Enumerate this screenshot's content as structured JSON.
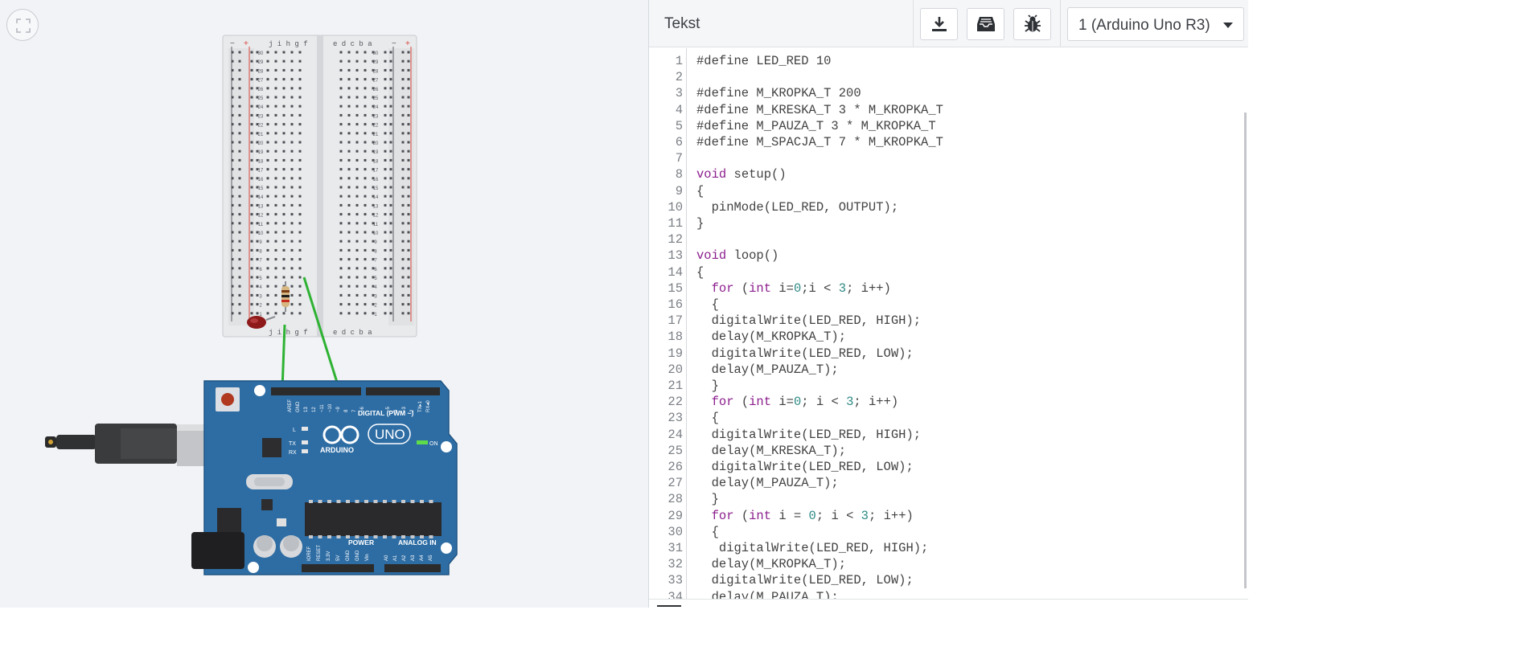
{
  "workspace": {
    "fit_icon": "fit-to-view-icon",
    "breadboard": {
      "row_numbers": [
        "30",
        "29",
        "28",
        "27",
        "26",
        "25",
        "24",
        "23",
        "22",
        "21",
        "20",
        "19",
        "18",
        "17",
        "16",
        "15",
        "14",
        "13",
        "12",
        "11",
        "10",
        "9",
        "8",
        "7",
        "6",
        "5",
        "4",
        "3",
        "2",
        "1"
      ],
      "left_columns": "j i h g f",
      "right_columns": "e d c b a",
      "rail_minus": "−",
      "rail_plus": "+"
    },
    "arduino": {
      "brand": "ARDUINO",
      "model": "UNO",
      "digital_label": "DIGITAL (PWM ~)",
      "power_label": "POWER",
      "analog_label": "ANALOG IN",
      "on_label": "ON",
      "tx_label": "TX",
      "rx_label": "RX",
      "l_label": "L",
      "digital_pins": [
        "AREF",
        "GND",
        "13",
        "12",
        "~11",
        "~10",
        "~9",
        "8",
        "7",
        "~6",
        "~5",
        "4",
        "~3",
        "2",
        "TX▸1",
        "RX◂0"
      ],
      "power_pins": [
        "IOREF",
        "RESET",
        "3.3V",
        "5V",
        "GND",
        "GND",
        "Vin"
      ],
      "analog_pins": [
        "A0",
        "A1",
        "A2",
        "A3",
        "A4",
        "A5"
      ]
    }
  },
  "code_panel": {
    "mode_label": "Tekst",
    "toolbar": {
      "download_icon": "download-icon",
      "libraries_icon": "libraries-icon",
      "debugger_icon": "bug-icon"
    },
    "device_select": {
      "value": "1 (Arduino Uno R3)"
    },
    "colors": {
      "keyword": "#8b1e8d",
      "number": "#2d8a84",
      "text": "#424242",
      "line_number": "#7a7e84"
    },
    "lines": [
      {
        "n": "1",
        "code": "#define LED_RED 10"
      },
      {
        "n": "2",
        "code": ""
      },
      {
        "n": "3",
        "code": "#define M_KROPKA_T 200"
      },
      {
        "n": "4",
        "code": "#define M_KRESKA_T 3 * M_KROPKA_T"
      },
      {
        "n": "5",
        "code": "#define M_PAUZA_T 3 * M_KROPKA_T"
      },
      {
        "n": "6",
        "code": "#define M_SPACJA_T 7 * M_KROPKA_T"
      },
      {
        "n": "7",
        "code": ""
      },
      {
        "n": "8",
        "code": "void setup()"
      },
      {
        "n": "9",
        "code": "{"
      },
      {
        "n": "10",
        "code": "  pinMode(LED_RED, OUTPUT);"
      },
      {
        "n": "11",
        "code": "}"
      },
      {
        "n": "12",
        "code": ""
      },
      {
        "n": "13",
        "code": "void loop()"
      },
      {
        "n": "14",
        "code": "{"
      },
      {
        "n": "15",
        "code": "  for (int i=0;i < 3; i++)"
      },
      {
        "n": "16",
        "code": "  {"
      },
      {
        "n": "17",
        "code": "  digitalWrite(LED_RED, HIGH);"
      },
      {
        "n": "18",
        "code": "  delay(M_KROPKA_T);"
      },
      {
        "n": "19",
        "code": "  digitalWrite(LED_RED, LOW);"
      },
      {
        "n": "20",
        "code": "  delay(M_PAUZA_T);"
      },
      {
        "n": "21",
        "code": "  }"
      },
      {
        "n": "22",
        "code": "  for (int i=0; i < 3; i++)"
      },
      {
        "n": "23",
        "code": "  {"
      },
      {
        "n": "24",
        "code": "  digitalWrite(LED_RED, HIGH);"
      },
      {
        "n": "25",
        "code": "  delay(M_KRESKA_T);"
      },
      {
        "n": "26",
        "code": "  digitalWrite(LED_RED, LOW);"
      },
      {
        "n": "27",
        "code": "  delay(M_PAUZA_T);"
      },
      {
        "n": "28",
        "code": "  }"
      },
      {
        "n": "29",
        "code": "  for (int i = 0; i < 3; i++)"
      },
      {
        "n": "30",
        "code": "  {"
      },
      {
        "n": "31",
        "code": "   digitalWrite(LED_RED, HIGH);"
      },
      {
        "n": "32",
        "code": "  delay(M_KROPKA_T);"
      },
      {
        "n": "33",
        "code": "  digitalWrite(LED_RED, LOW);"
      },
      {
        "n": "34",
        "code": "  delay(M_PAUZA_T);"
      }
    ]
  }
}
